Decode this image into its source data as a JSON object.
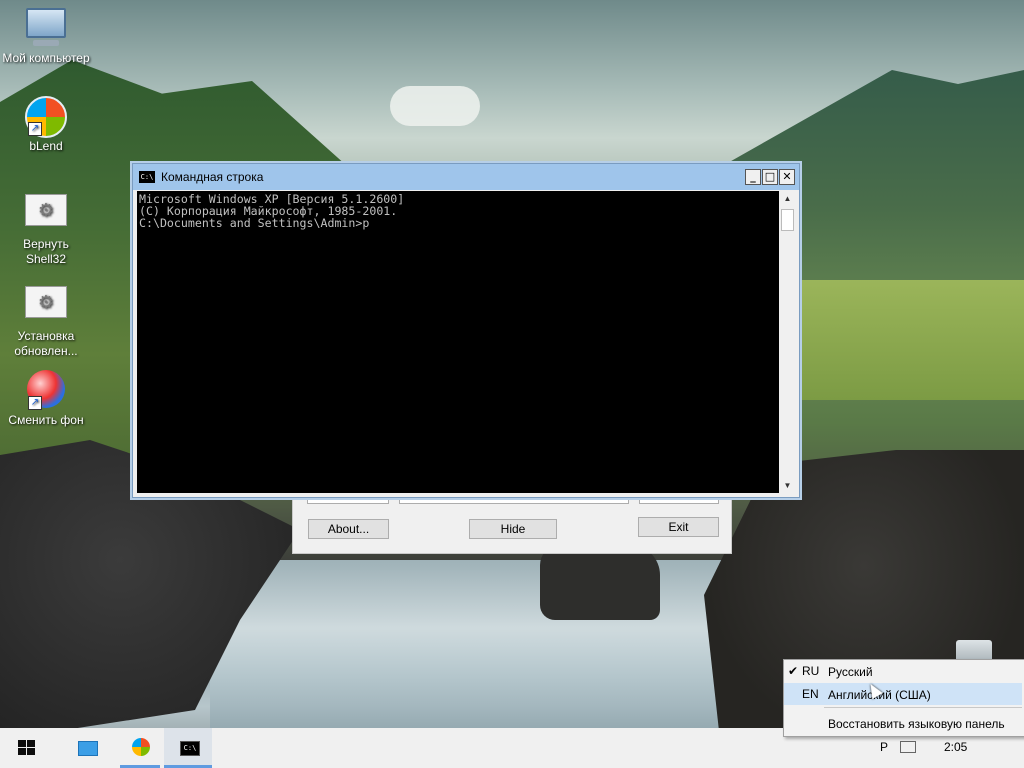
{
  "desktop": {
    "icons": [
      {
        "label": "Мой компьютер"
      },
      {
        "label": "bLend"
      },
      {
        "label": "Вернуть Shell32"
      },
      {
        "label": "Установка обновлен..."
      },
      {
        "label": "Сменить фон"
      }
    ]
  },
  "background_dialog": {
    "about_label": "About...",
    "hide_label": "Hide",
    "exit_label": "Exit"
  },
  "console": {
    "title": "Командная строка",
    "icon_text": "C:\\",
    "minimize_glyph": "_",
    "maximize_glyph": "□",
    "close_glyph": "✕",
    "lines": [
      "Microsoft Windows XP [Версия 5.1.2600]",
      "(С) Корпорация Майкрософт, 1985-2001.",
      "",
      "C:\\Documents and Settings\\Admin>p"
    ]
  },
  "taskbar": {
    "items": [
      {
        "name": "start",
        "active": false
      },
      {
        "name": "desktop",
        "active": false
      },
      {
        "name": "windows-app",
        "active": true
      },
      {
        "name": "command-prompt",
        "active": true
      }
    ],
    "tray_lang": "Р",
    "clock": "2:05",
    "cmd_icon_text": "C:\\"
  },
  "language_menu": {
    "items": [
      {
        "code": "RU",
        "name": "Русский",
        "checked": true
      },
      {
        "code": "EN",
        "name": "Английский (США)",
        "checked": false
      }
    ],
    "check_glyph": "✔",
    "restore_label": "Восстановить языковую панель"
  },
  "colors": {
    "title_bar": "#9fc5eb",
    "taskbar": "#f0f0f0",
    "active_indicator": "#5f9be0",
    "menu_hover": "#cfe3f7"
  }
}
